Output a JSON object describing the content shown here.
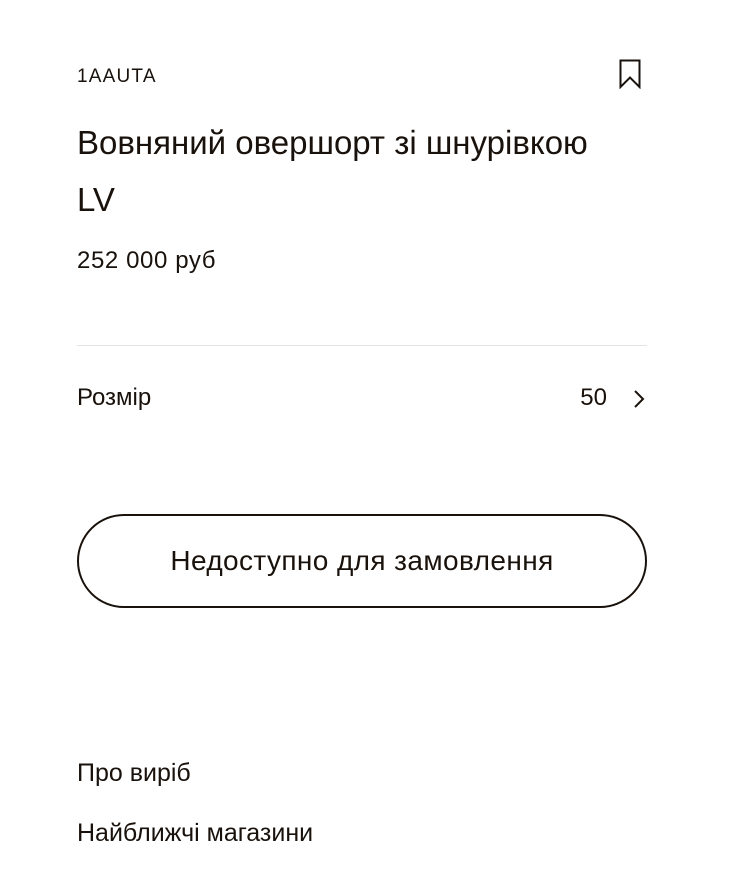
{
  "product": {
    "sku": "1AAUTA",
    "title": "Вовняний овершорт зі шнурівкою LV",
    "price": "252 000 руб"
  },
  "icons": {
    "bookmark": "bookmark-icon",
    "size_chevron": "chevron-right-icon"
  },
  "size": {
    "label": "Розмір",
    "value": "50"
  },
  "order_button": {
    "label": "Недоступно для замовлення"
  },
  "links": {
    "about": "Про виріб",
    "stores": "Найближчі магазини"
  },
  "colors": {
    "text": "#19110b",
    "divider": "#e6e4e2",
    "background": "#ffffff"
  }
}
